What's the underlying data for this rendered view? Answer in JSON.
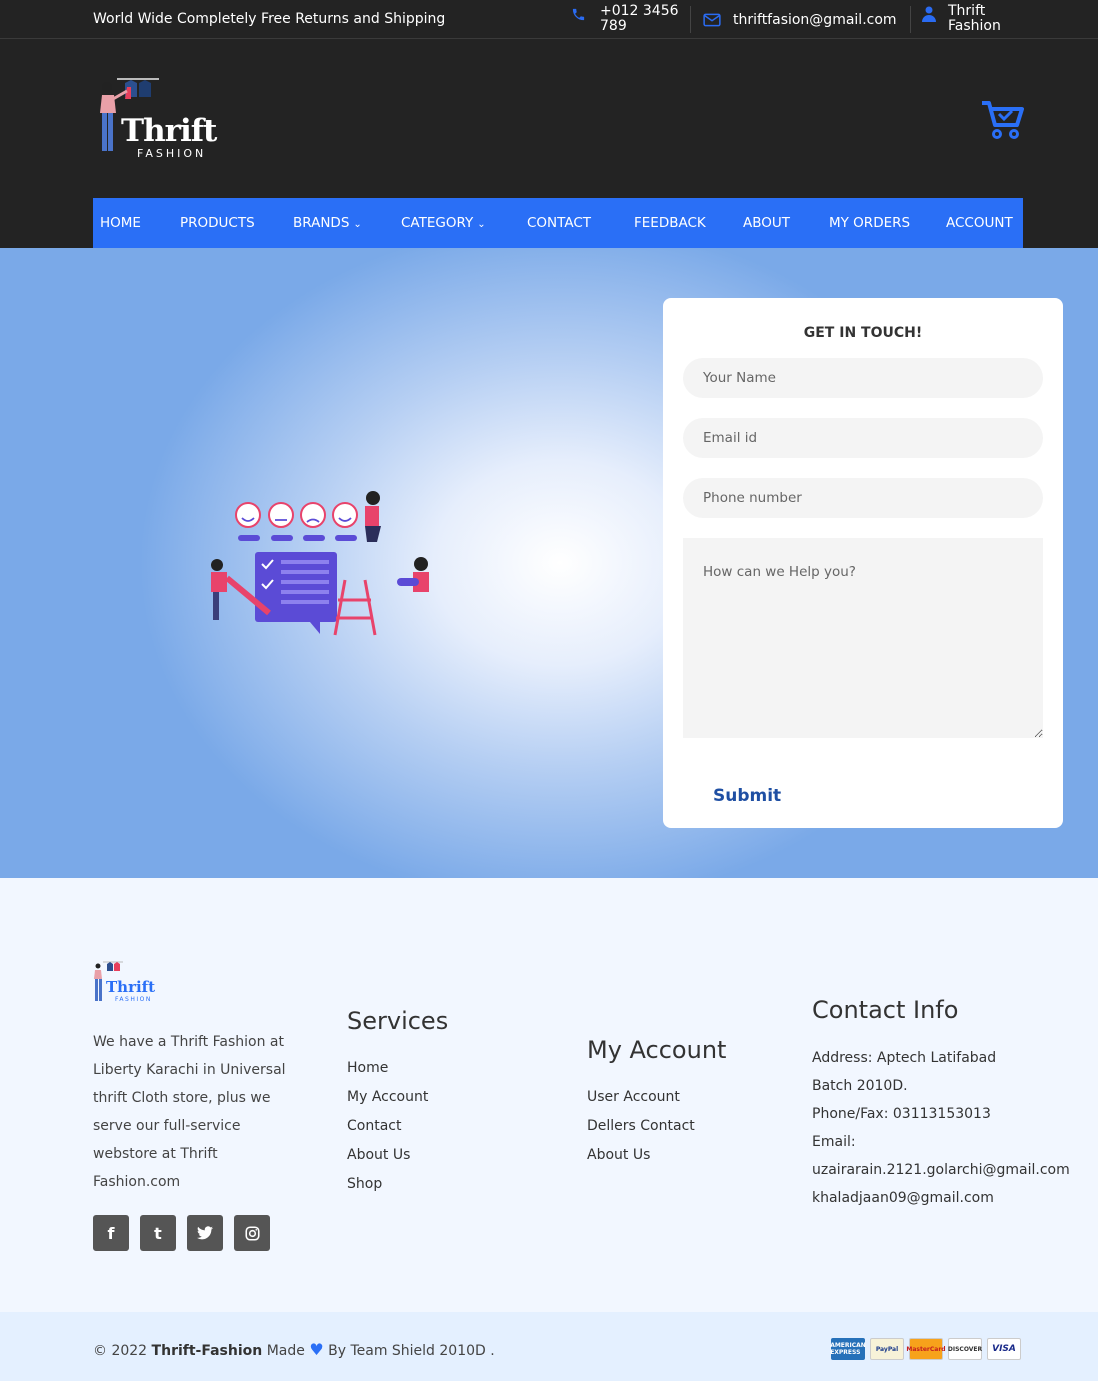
{
  "topbar": {
    "promo": "World Wide Completely Free Returns and Shipping",
    "phone": "+012 3456 789",
    "email": "thriftfasion@gmail.com",
    "user": "Thrift Fashion"
  },
  "header": {
    "logo_title": "Thrift",
    "logo_sub": "FASHION"
  },
  "nav": {
    "items": [
      {
        "label": "HOME"
      },
      {
        "label": "PRODUCTS"
      },
      {
        "label": "BRANDS"
      },
      {
        "label": "CATEGORY"
      },
      {
        "label": "CONTACT"
      },
      {
        "label": "FEEDBACK"
      },
      {
        "label": "ABOUT"
      },
      {
        "label": "MY ORDERS"
      },
      {
        "label": "ACCOUNT"
      }
    ],
    "dropdown_glyph": "⌄"
  },
  "form": {
    "title": "GET IN TOUCH!",
    "name_placeholder": "Your Name",
    "email_placeholder": "Email id",
    "phone_placeholder": "Phone number",
    "message_placeholder": "How can we Help you?",
    "submit_label": "Submit"
  },
  "footer": {
    "logo_title": "Thrift",
    "logo_sub": "FASHION",
    "about": "We have a Thrift Fashion at Liberty Karachi in Universal thrift Cloth store, plus we serve our full-service webstore at Thrift Fashion.com",
    "social": [
      "f",
      "t",
      "🐦",
      "◎"
    ],
    "services": {
      "title": "Services",
      "items": [
        "Home",
        "My Account",
        "Contact",
        "About Us",
        "Shop"
      ]
    },
    "account": {
      "title": "My Account",
      "items": [
        "User Account",
        "Dellers Contact",
        "About Us"
      ]
    },
    "contact": {
      "title": "Contact Info",
      "lines": [
        "Address: Aptech Latifabad",
        "Batch 2010D.",
        "Phone/Fax: 03113153013",
        "Email:",
        "uzairarain.2121.golarchi@gmail.com",
        "khaladjaan09@gmail.com"
      ]
    }
  },
  "bottom": {
    "copy_prefix": "© 2022",
    "brand": "Thrift-Fashion",
    "made": "Made",
    "by": "By Team Shield 2010D .",
    "cards": [
      "AMERICAN EXPRESS",
      "PayPal",
      "MasterCard",
      "DISCOVER",
      "VISA"
    ]
  },
  "colors": {
    "accent": "#2a6ff6",
    "dark": "#232323",
    "footer_bg": "#f2f7ff"
  }
}
